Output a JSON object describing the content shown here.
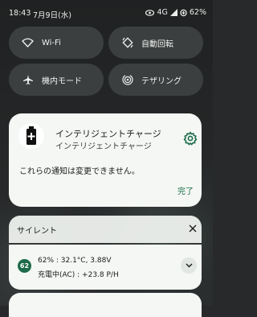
{
  "status_bar": {
    "time": "18:43",
    "date": "7月9日(水)",
    "network": "4G",
    "battery": "62%"
  },
  "quick_settings": {
    "tiles": [
      {
        "label": "Wi-Fi",
        "icon": "wifi-icon"
      },
      {
        "label": "自動回転",
        "icon": "auto-rotate-icon"
      },
      {
        "label": "機内モード",
        "icon": "airplane-icon"
      },
      {
        "label": "テザリング",
        "icon": "hotspot-icon"
      }
    ]
  },
  "notification_card": {
    "title": "インテリジェントチャージ",
    "subtitle": "インテリジェントチャージ",
    "message": "これらの通知は変更できません。",
    "done_label": "完了"
  },
  "silent_section": {
    "label": "サイレント"
  },
  "battery_notification": {
    "badge": "62",
    "line1": "62% : 32.1°C, 3.88V",
    "line2": "充電中(AC) : +23.8 P/H"
  },
  "colors": {
    "accent": "#1d6b4b",
    "card_bg": "#f4f7f4",
    "tile_bg": "#3c3f3f"
  }
}
